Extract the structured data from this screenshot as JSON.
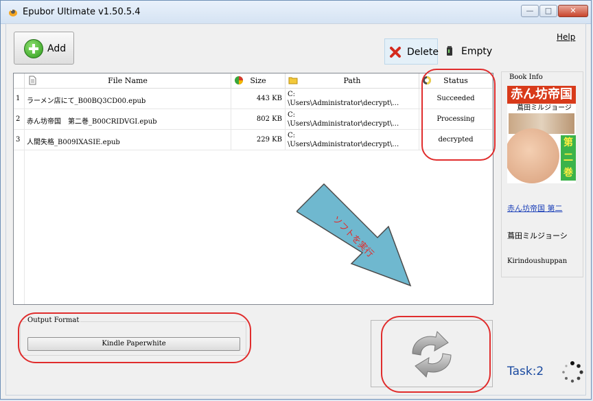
{
  "window": {
    "title": "Epubor Ultimate v1.50.5.4",
    "minimize": "—",
    "maximize": "□",
    "close": "✕"
  },
  "toolbar": {
    "add_label": "Add",
    "delete_label": "Delete",
    "empty_label": "Empty",
    "help_label": "Help"
  },
  "table": {
    "columns": [
      "",
      "File Name",
      "Size",
      "Path",
      "Status"
    ],
    "rows": [
      {
        "num": "1",
        "name": "ラーメン店にて_B00BQ3CD00.epub",
        "size": "443 KB",
        "path": "C:\n\\Users\\Administrator\\decrypt\\…",
        "status": "Succeeded"
      },
      {
        "num": "2",
        "name": "赤ん坊帝国　第二巻_B00CRIDVGI.epub",
        "size": "802 KB",
        "path": "C:\n\\Users\\Administrator\\decrypt\\…",
        "status": "Processing"
      },
      {
        "num": "3",
        "name": "人間失格_B009IXASIE.epub",
        "size": "229 KB",
        "path": "C:\n\\Users\\Administrator\\decrypt\\…",
        "status": "decrypted"
      }
    ]
  },
  "book_info": {
    "label": "Book Info",
    "cover_title": "赤ん坊帝国",
    "cover_author": "蔦田ミルジョージ",
    "cover_volume": "第二巻",
    "title": "赤ん坊帝国 第二",
    "author": "蔦田ミルジョーシ",
    "publisher": "Kirindoushuppan"
  },
  "annotation": {
    "arrow_text": "ソフトを実行",
    "arrow_color": "#6fb8cf",
    "highlight_color": "#e02c2c"
  },
  "output": {
    "label": "Output Format",
    "format": "Kindle Paperwhite"
  },
  "task": {
    "label": "Task:2"
  },
  "colors": {
    "accent": "#1a4aa0",
    "link": "#1a3fb8"
  }
}
